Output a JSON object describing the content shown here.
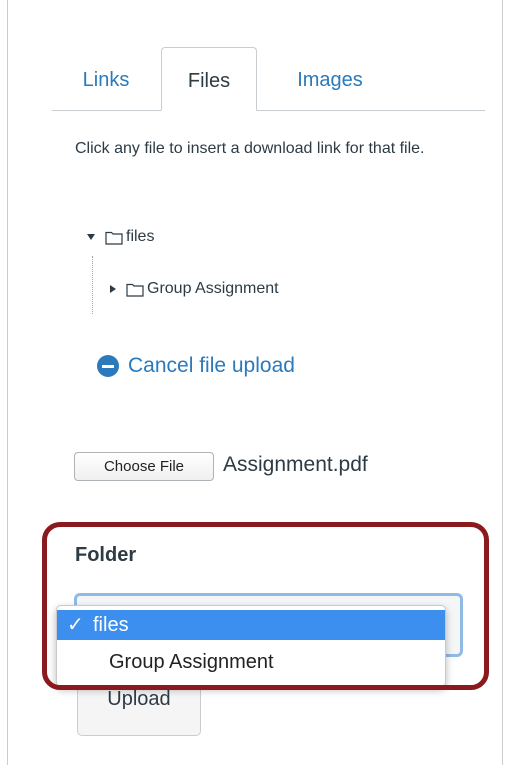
{
  "tabs": [
    {
      "label": "Links"
    },
    {
      "label": "Files"
    },
    {
      "label": "Images"
    }
  ],
  "files_panel": {
    "instructions": "Click any file to insert a download link for that file.",
    "tree": {
      "root": "files",
      "children": [
        "Group Assignment"
      ]
    },
    "cancel_label": "Cancel file upload",
    "choose_file_label": "Choose File",
    "selected_file": "Assignment.pdf",
    "folder_label": "Folder",
    "folder_options": [
      {
        "label": "files",
        "selected": true,
        "check": "✓"
      },
      {
        "label": "Group Assignment",
        "selected": false
      }
    ],
    "upload_label": "Upload"
  },
  "colors": {
    "link": "#2a7abc",
    "selected_option": "#3d8fef",
    "highlight": "#8b1a1f"
  }
}
